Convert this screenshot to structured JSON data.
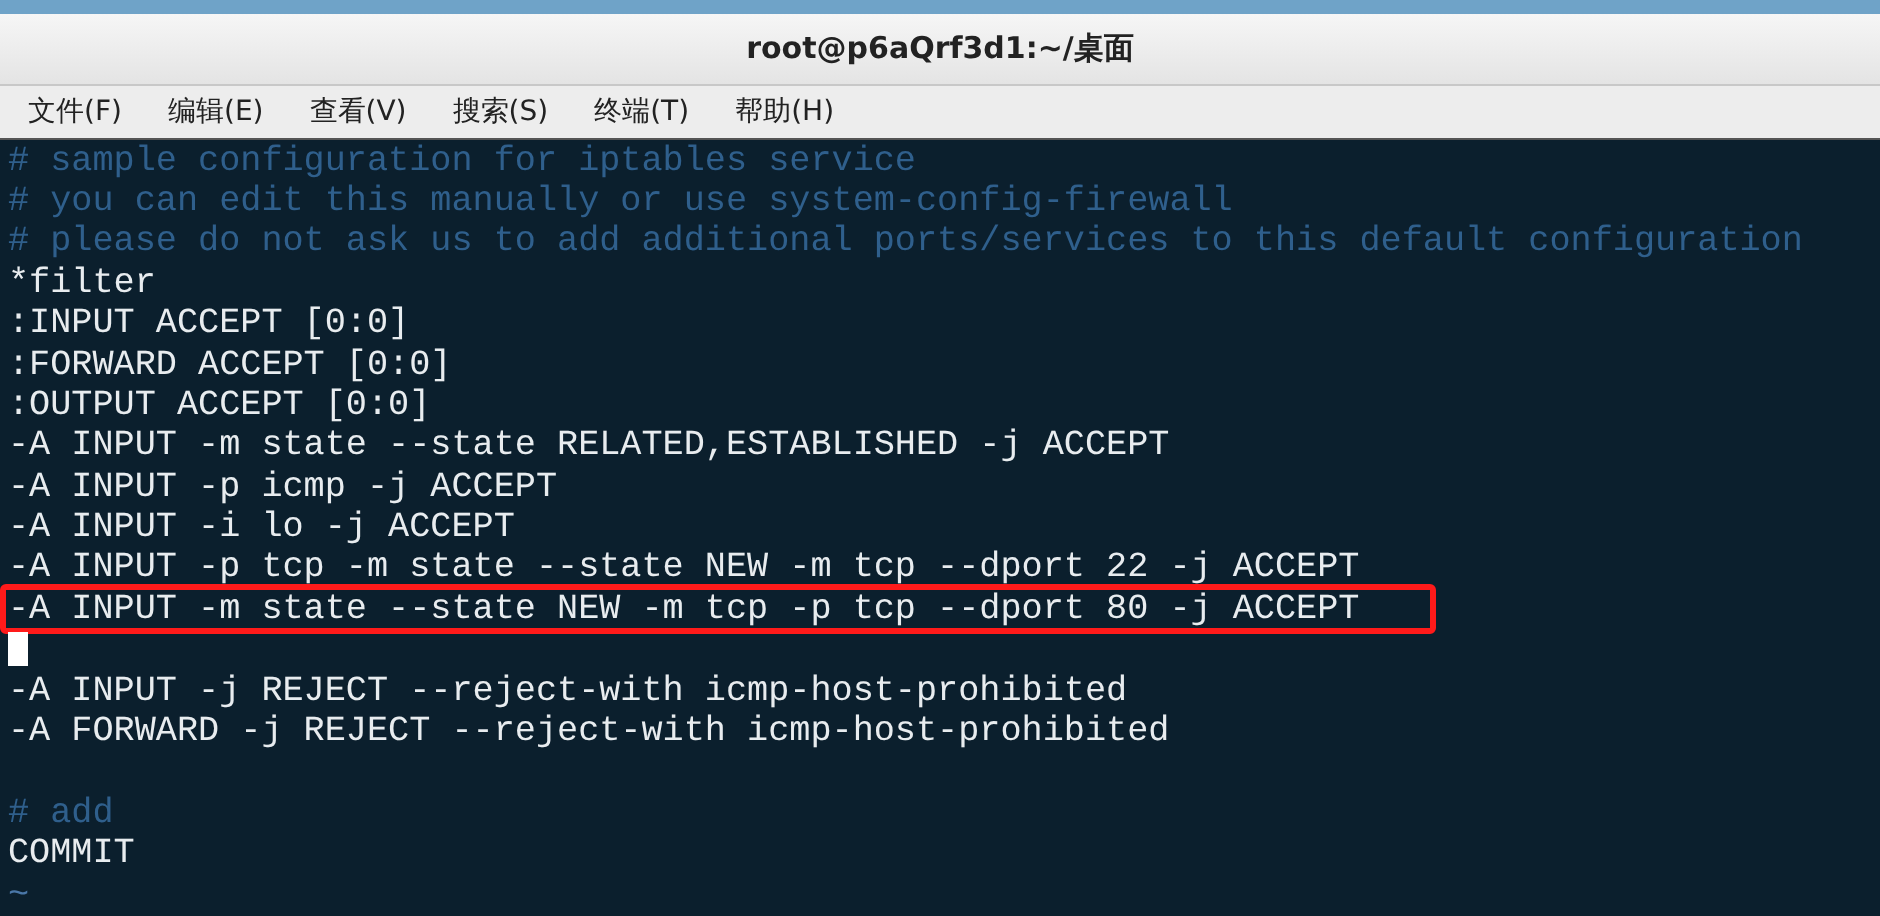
{
  "window": {
    "title": "root@p6aQrf3d1:~/桌面"
  },
  "menu": [
    "文件(F)",
    "编辑(E)",
    "查看(V)",
    "搜索(S)",
    "终端(T)",
    "帮助(H)"
  ],
  "terminal": {
    "lines": [
      {
        "kind": "comment",
        "text": "# sample configuration for iptables service",
        "highlighted": false
      },
      {
        "kind": "comment",
        "text": "# you can edit this manually or use system-config-firewall",
        "highlighted": false
      },
      {
        "kind": "comment",
        "text": "# please do not ask us to add additional ports/services to this default configuration",
        "highlighted": false
      },
      {
        "kind": "text",
        "text": "*filter",
        "highlighted": false
      },
      {
        "kind": "text",
        "text": ":INPUT ACCEPT [0:0]",
        "highlighted": false
      },
      {
        "kind": "text",
        "text": ":FORWARD ACCEPT [0:0]",
        "highlighted": false
      },
      {
        "kind": "text",
        "text": ":OUTPUT ACCEPT [0:0]",
        "highlighted": false
      },
      {
        "kind": "text",
        "text": "-A INPUT -m state --state RELATED,ESTABLISHED -j ACCEPT",
        "highlighted": false
      },
      {
        "kind": "text",
        "text": "-A INPUT -p icmp -j ACCEPT",
        "highlighted": false
      },
      {
        "kind": "text",
        "text": "-A INPUT -i lo -j ACCEPT",
        "highlighted": false
      },
      {
        "kind": "text",
        "text": "-A INPUT -p tcp -m state --state NEW -m tcp --dport 22 -j ACCEPT",
        "highlighted": false
      },
      {
        "kind": "text",
        "text": "-A INPUT -m state --state NEW -m tcp -p tcp --dport 80 -j ACCEPT",
        "highlighted": true
      },
      {
        "kind": "cursor",
        "highlighted": false
      },
      {
        "kind": "text",
        "text": "-A INPUT -j REJECT --reject-with icmp-host-prohibited",
        "highlighted": false
      },
      {
        "kind": "text",
        "text": "-A FORWARD -j REJECT --reject-with icmp-host-prohibited",
        "highlighted": false
      },
      {
        "kind": "blank",
        "highlighted": false
      },
      {
        "kind": "comment",
        "text": "# add",
        "highlighted": false
      },
      {
        "kind": "text",
        "text": "COMMIT",
        "highlighted": false
      },
      {
        "kind": "tilde",
        "text": "~",
        "highlighted": false
      }
    ]
  }
}
